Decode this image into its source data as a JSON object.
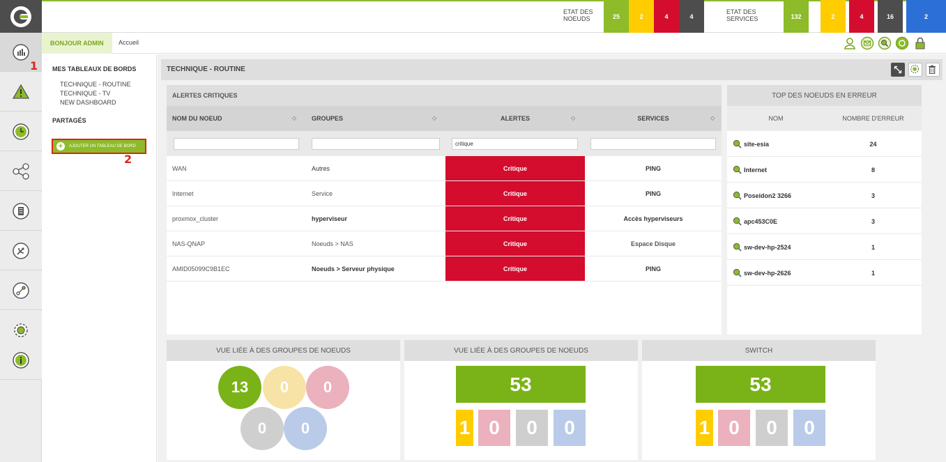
{
  "status_bar": {
    "nodes_label": "ETAT DES NOEUDS",
    "nodes": [
      "25",
      "2",
      "4",
      "4"
    ],
    "services_label": "ETAT DES SERVICES",
    "services": [
      "132",
      "2",
      "4",
      "16",
      "2"
    ],
    "colors": {
      "ok": "#8dbb2a",
      "warning": "#ffcc00",
      "critical": "#d40c2d",
      "unknown": "#4d4d4d",
      "info": "#2c6fd6"
    }
  },
  "breadcrumb": {
    "greeting": "BONJOUR ADMIN",
    "home": "Accueil"
  },
  "sidebar": {
    "my_dashboards": "MES TABLEAUX DE BORDS",
    "dashboards": [
      "TECHNIQUE - ROUTINE",
      "TECHNIQUE - TV",
      "NEW DASHBOARD"
    ],
    "shared": "PARTAGÉS",
    "add_button": "AJOUTER UN TABLEAU DE BORD"
  },
  "markers": {
    "one": "1",
    "two": "2"
  },
  "page": {
    "title": "TECHNIQUE - ROUTINE"
  },
  "alerts": {
    "title": "ALERTES CRITIQUES",
    "columns": [
      "NOM DU NOEUD",
      "GROUPES",
      "ALERTES",
      "SERVICES"
    ],
    "filters": [
      "",
      "",
      "critique",
      ""
    ],
    "rows": [
      {
        "node": "WAN",
        "group": "Autres",
        "alert": "Critique",
        "service": "PING"
      },
      {
        "node": "Internet",
        "group": "Service",
        "alert": "Critique",
        "service": "PING"
      },
      {
        "node": "proxmox_cluster",
        "group": "hyperviseur",
        "alert": "Critique",
        "service": "Accès hyperviseurs"
      },
      {
        "node": "NAS-QNAP",
        "group": "Noeuds > NAS",
        "alert": "Critique",
        "service": "Espace Disque"
      },
      {
        "node": "AMID05099C9B1EC",
        "group": "Noeuds > Serveur physique",
        "alert": "Critique",
        "service": "PING"
      }
    ]
  },
  "top_nodes": {
    "title": "TOP DES NOEUDS EN ERREUR",
    "col_name": "NOM",
    "col_count": "NOMBRE D'ERREUR",
    "rows": [
      {
        "name": "site-esia",
        "count": "24"
      },
      {
        "name": "Internet",
        "count": "8"
      },
      {
        "name": "Poseidon2 3266",
        "count": "3"
      },
      {
        "name": "apc453C0E",
        "count": "3"
      },
      {
        "name": "sw-dev-hp-2524",
        "count": "1"
      },
      {
        "name": "sw-dev-hp-2626",
        "count": "1"
      }
    ]
  },
  "widgets": [
    {
      "title": "VUE LIÉE À DES GROUPES DE NOEUDS",
      "values": [
        "13",
        "0",
        "0",
        "0",
        "0"
      ]
    },
    {
      "title": "VUE LIÉE À DES GROUPES DE NOEUDS",
      "total": "53",
      "values": [
        "1",
        "0",
        "0",
        "0"
      ]
    },
    {
      "title": "SWITCH",
      "total": "53",
      "values": [
        "1",
        "0",
        "0",
        "0"
      ]
    }
  ]
}
